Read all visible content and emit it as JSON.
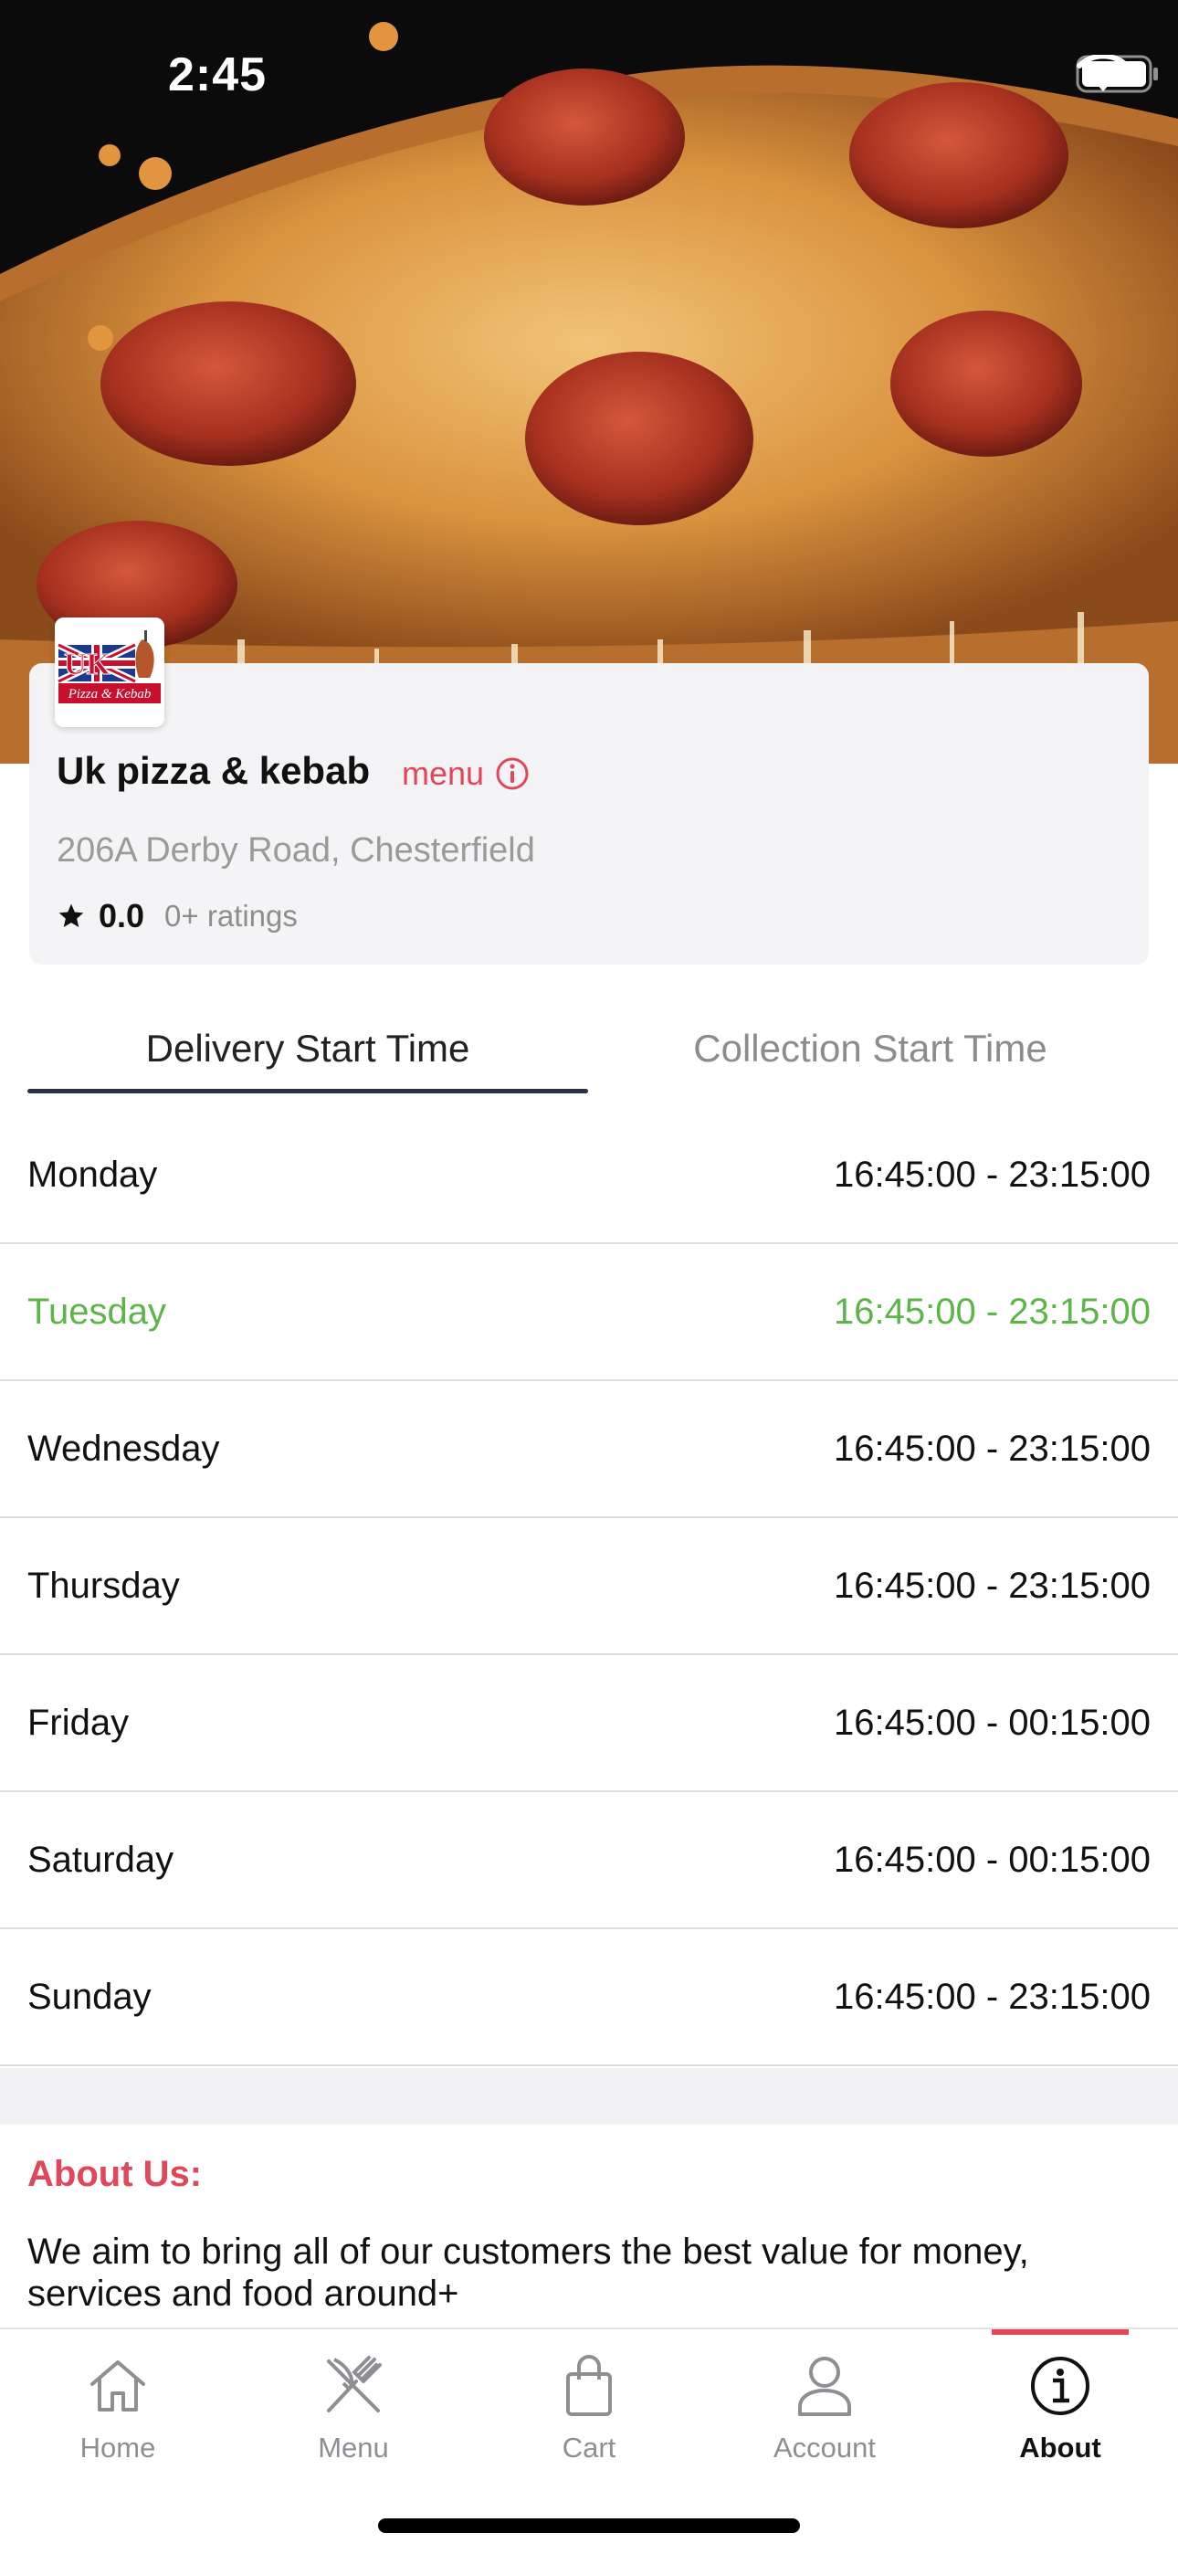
{
  "status_bar": {
    "time": "2:45",
    "icons": [
      "wifi-icon",
      "battery-icon"
    ]
  },
  "hero": {
    "image": "pepperoni-pizza-slice-photo"
  },
  "restaurant": {
    "logo_text": "UK Pizza & Kebab",
    "name": "Uk pizza & kebab",
    "menu_link": "menu",
    "address": "206A Derby Road, Chesterfield",
    "rating": "0.0",
    "ratings_count": "0+ ratings"
  },
  "tabs": [
    {
      "label": "Delivery Start Time",
      "active": true
    },
    {
      "label": "Collection Start Time",
      "active": false
    }
  ],
  "schedule": [
    {
      "day": "Monday",
      "hours": "16:45:00 - 23:15:00"
    },
    {
      "day": "Tuesday",
      "hours": "16:45:00 - 23:15:00",
      "today": true
    },
    {
      "day": "Wednesday",
      "hours": "16:45:00 - 23:15:00"
    },
    {
      "day": "Thursday",
      "hours": "16:45:00 - 23:15:00"
    },
    {
      "day": "Friday",
      "hours": "16:45:00 - 00:15:00"
    },
    {
      "day": "Saturday",
      "hours": "16:45:00 - 00:15:00"
    },
    {
      "day": "Sunday",
      "hours": "16:45:00 - 23:15:00"
    }
  ],
  "about": {
    "title": "About Us:",
    "text": "We aim to bring all of our customers the best value for money, services and food around+"
  },
  "tabbar": [
    {
      "label": "Home",
      "icon": "home-icon"
    },
    {
      "label": "Menu",
      "icon": "fork-knife-icon"
    },
    {
      "label": "Cart",
      "icon": "shopping-bag-icon"
    },
    {
      "label": "Account",
      "icon": "user-icon"
    },
    {
      "label": "About",
      "icon": "info-icon",
      "active": true
    }
  ],
  "colors": {
    "accent": "#e0475b",
    "today": "#5db548",
    "tab_underline": "#2b3243",
    "muted": "#8e8e93"
  }
}
